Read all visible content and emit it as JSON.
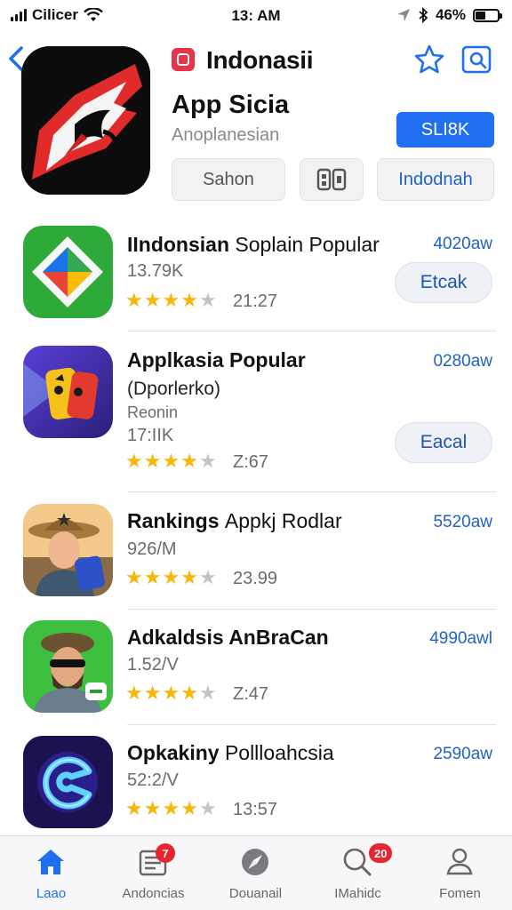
{
  "status_bar": {
    "carrier": "Cilicer",
    "time": "13: AM",
    "battery_percent": "46%",
    "battery_level": 0.46
  },
  "header": {
    "country": "Indonasii",
    "title": "App Sicia",
    "subtitle": "Anoplanesian",
    "primary_button": "SLI8K",
    "segments": [
      "Sahon",
      "Indodnah"
    ],
    "icon_color": "#e8344a"
  },
  "apps": [
    {
      "title_bold": "IIndonsian",
      "title_light": "Soplain Popular",
      "line1": "13.79K",
      "rating": "21:27",
      "stars": 4,
      "price": "4020aw",
      "action": "Etcak"
    },
    {
      "title_bold": "Applkasia Popular",
      "title_light": "",
      "line1": "(Dporlerko)",
      "line2": "Reonin",
      "line3": "17:IIK",
      "rating": "Z:67",
      "stars": 4,
      "price": "0280aw",
      "action": "Eacal"
    },
    {
      "title_bold": "Rankings",
      "title_light": "Appkj Rodlar",
      "line1": "926/M",
      "rating": "23.99",
      "stars": 4,
      "price": "5520aw"
    },
    {
      "title_bold": "Adkaldsis AnBraCan",
      "title_light": "",
      "line1": "1.52/V",
      "rating": "Z:47",
      "stars": 4,
      "price": "4990awl"
    },
    {
      "title_bold": "Opkakiny",
      "title_light": "Pollloahcsia",
      "line1": "52:2/V",
      "rating": "13:57",
      "stars": 4,
      "price": "2590aw"
    }
  ],
  "tab_bar": {
    "tabs": [
      {
        "label": "Laao",
        "icon": "home-icon",
        "active": true
      },
      {
        "label": "Andoncias",
        "icon": "news-icon",
        "badge": "7"
      },
      {
        "label": "Douanail",
        "icon": "compass-icon"
      },
      {
        "label": "IMahidc",
        "icon": "search-icon",
        "badge": "20"
      },
      {
        "label": "Fomen",
        "icon": "person-icon"
      }
    ]
  },
  "colors": {
    "accent": "#1f6ff0",
    "star": "#f6b70b",
    "badge": "#e8242e"
  }
}
